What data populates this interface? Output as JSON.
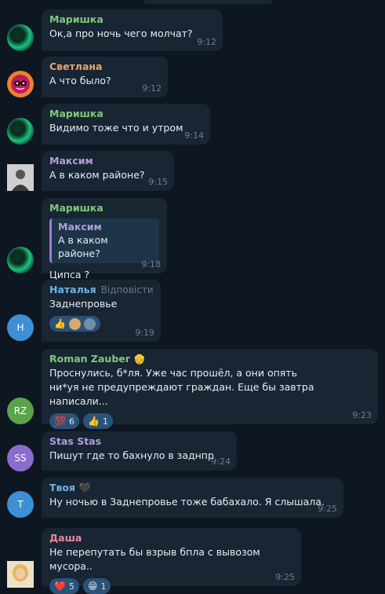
{
  "colors": {
    "background": "#0e1621",
    "bubble": "#182533",
    "time": "#6d7f8f",
    "text": "#e8eef3",
    "reaction_bg": "#2b5278"
  },
  "messages": [
    {
      "sender": "Маришка",
      "sender_color": "#7fc97a",
      "text": "Ок,а про ночь чего молчат?",
      "time": "9:12",
      "avatar_kind": "green-swirl"
    },
    {
      "sender": "Светлана",
      "sender_color": "#e7a56c",
      "text": "А что было?",
      "time": "9:12",
      "avatar_kind": "pink-mask"
    },
    {
      "sender": "Маришка",
      "sender_color": "#7fc97a",
      "text": "Видимо тоже что и утром",
      "time": "9:14",
      "avatar_kind": "green-swirl"
    },
    {
      "sender": "Максим",
      "sender_color": "#b39ddb",
      "text": "А в каком районе?",
      "time": "9:15",
      "avatar_kind": "photo-grey"
    },
    {
      "sender": "Маришка",
      "sender_color": "#7fc97a",
      "quote_sender": "Максим",
      "quote_text": "А в каком районе?",
      "text": "Ципса ?",
      "time": "9:18",
      "avatar_kind": "green-swirl"
    },
    {
      "sender": "Наталья",
      "sender_color": "#6fb4e6",
      "reply_hint": "Відповісти",
      "text": "Заднепровье",
      "time": "9:19",
      "avatar_initials": "Н",
      "avatar_color": "#3d8fd6",
      "reactions": [
        {
          "emoji": "👍"
        }
      ]
    },
    {
      "sender": "Roman Zauber",
      "sender_color": "#7fc97a",
      "sender_emoji": "👴",
      "text": "Проснулись, б*ля. Уже час прошёл, а они опять ни*уя не предупреждают граждан. Еще бы завтра написали...",
      "time": "9:23",
      "avatar_initials": "RZ",
      "avatar_color": "#5aa34a",
      "reactions": [
        {
          "emoji": "💯",
          "count": "6"
        },
        {
          "emoji": "👍",
          "count": "1"
        }
      ]
    },
    {
      "sender": "Stas Stas",
      "sender_color": "#b39ddb",
      "text": "Пишут где то бахнуло в заднпр",
      "time": "9:24",
      "avatar_initials": "SS",
      "avatar_color": "#8a6ccf"
    },
    {
      "sender": "Твоя",
      "sender_color": "#6fb4e6",
      "sender_emoji": "🖤",
      "text": "Ну ночью в Заднепровье тоже бабахало. Я слышала.",
      "time": "9:25",
      "avatar_initials": "T",
      "avatar_color": "#3d8fd6"
    },
    {
      "sender": "Даша",
      "sender_color": "#e58a9c",
      "text": "Не перепутать бы взрыв бпла с вывозом мусора..",
      "time": "9:25",
      "avatar_kind": "photo-blonde",
      "reactions": [
        {
          "emoji": "❤️",
          "count": "5"
        },
        {
          "emoji": "😁",
          "count": "1"
        }
      ]
    }
  ]
}
